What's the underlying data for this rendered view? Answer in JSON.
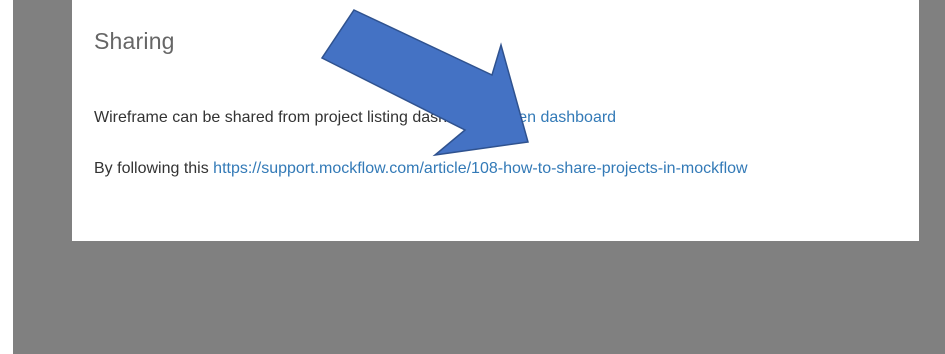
{
  "dialog": {
    "title": "Sharing",
    "line1_text": "Wireframe can be shared from project listing dashboard.",
    "line1_link": "Open dashboard",
    "line2_text": "By following this",
    "line2_link": "https://support.mockflow.com/article/108-how-to-share-projects-in-mockflow"
  },
  "colors": {
    "backdrop": "#808080",
    "dialog_bg": "#ffffff",
    "title": "#666666",
    "body_text": "#333333",
    "link": "#337ab7",
    "annotation_arrow_fill": "#4472c4",
    "annotation_arrow_stroke": "#2f528f"
  },
  "annotation": {
    "icon": "arrow-down-right-icon"
  }
}
